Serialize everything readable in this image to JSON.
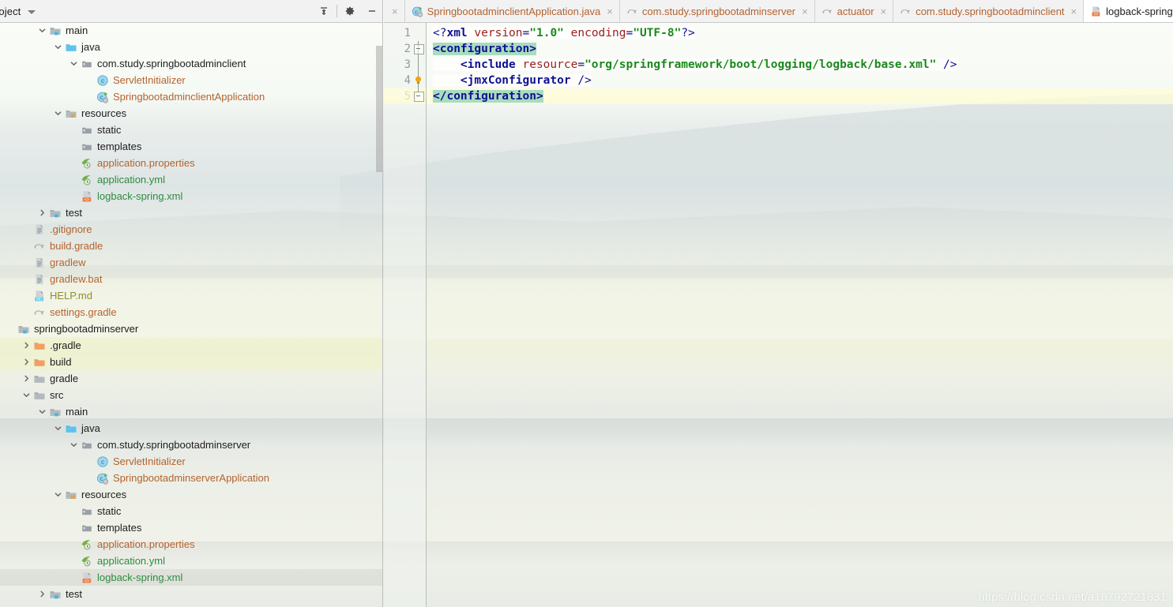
{
  "panel": {
    "title": "roject",
    "caret_icon": "chevron-down-icon",
    "tools": [
      {
        "name": "collapse-all-icon",
        "label": "Collapse All"
      },
      {
        "name": "gear-icon",
        "label": "Settings"
      },
      {
        "name": "minimize-icon",
        "label": "Hide"
      }
    ]
  },
  "tree": [
    {
      "depth": 2,
      "label": "main",
      "icon": "source-folder-icon",
      "arrow": "down",
      "color": "dark"
    },
    {
      "depth": 3,
      "label": "java",
      "icon": "java-folder-icon",
      "arrow": "down",
      "color": "dark"
    },
    {
      "depth": 4,
      "label": "com.study.springbootadminclient",
      "icon": "package-icon",
      "arrow": "down",
      "color": "dark"
    },
    {
      "depth": 5,
      "label": "ServletInitializer",
      "icon": "class-icon",
      "arrow": "none",
      "color": "orange"
    },
    {
      "depth": 5,
      "label": "SpringbootadminclientApplication",
      "icon": "runnable-class-icon",
      "arrow": "none",
      "color": "orange"
    },
    {
      "depth": 3,
      "label": "resources",
      "icon": "resources-folder-icon",
      "arrow": "down",
      "color": "dark"
    },
    {
      "depth": 4,
      "label": "static",
      "icon": "folder-icon",
      "arrow": "none",
      "color": "dark"
    },
    {
      "depth": 4,
      "label": "templates",
      "icon": "folder-icon",
      "arrow": "none",
      "color": "dark"
    },
    {
      "depth": 4,
      "label": "application.properties",
      "icon": "spring-properties-icon",
      "arrow": "none",
      "color": "orange"
    },
    {
      "depth": 4,
      "label": "application.yml",
      "icon": "spring-yaml-icon",
      "arrow": "none",
      "color": "green"
    },
    {
      "depth": 4,
      "label": "logback-spring.xml",
      "icon": "xml-icon",
      "arrow": "none",
      "color": "green"
    },
    {
      "depth": 2,
      "label": "test",
      "icon": "test-folder-icon",
      "arrow": "right",
      "color": "dark"
    },
    {
      "depth": 1,
      "label": ".gitignore",
      "icon": "file-icon",
      "arrow": "none",
      "color": "orange"
    },
    {
      "depth": 1,
      "label": "build.gradle",
      "icon": "gradle-icon",
      "arrow": "none",
      "color": "orange"
    },
    {
      "depth": 1,
      "label": "gradlew",
      "icon": "file-icon",
      "arrow": "none",
      "color": "orange"
    },
    {
      "depth": 1,
      "label": "gradlew.bat",
      "icon": "file-icon",
      "arrow": "none",
      "color": "orange"
    },
    {
      "depth": 1,
      "label": "HELP.md",
      "icon": "markdown-icon",
      "arrow": "none",
      "color": "olive"
    },
    {
      "depth": 1,
      "label": "settings.gradle",
      "icon": "gradle-icon",
      "arrow": "none",
      "color": "orange"
    },
    {
      "depth": 0,
      "label": "springbootadminserver",
      "icon": "module-icon",
      "arrow": "none",
      "color": "dark"
    },
    {
      "depth": 1,
      "label": ".gradle",
      "icon": "excluded-folder-icon",
      "arrow": "right",
      "color": "dark",
      "highlight": "a"
    },
    {
      "depth": 1,
      "label": "build",
      "icon": "excluded-folder-icon",
      "arrow": "right",
      "color": "dark",
      "highlight": "a"
    },
    {
      "depth": 1,
      "label": "gradle",
      "icon": "plain-folder-icon",
      "arrow": "right",
      "color": "dark"
    },
    {
      "depth": 1,
      "label": "src",
      "icon": "plain-folder-icon",
      "arrow": "down",
      "color": "dark"
    },
    {
      "depth": 2,
      "label": "main",
      "icon": "source-folder-icon",
      "arrow": "down",
      "color": "dark"
    },
    {
      "depth": 3,
      "label": "java",
      "icon": "java-folder-icon",
      "arrow": "down",
      "color": "dark"
    },
    {
      "depth": 4,
      "label": "com.study.springbootadminserver",
      "icon": "package-icon",
      "arrow": "down",
      "color": "dark"
    },
    {
      "depth": 5,
      "label": "ServletInitializer",
      "icon": "class-icon",
      "arrow": "none",
      "color": "orange"
    },
    {
      "depth": 5,
      "label": "SpringbootadminserverApplication",
      "icon": "runnable-class-icon",
      "arrow": "none",
      "color": "orange"
    },
    {
      "depth": 3,
      "label": "resources",
      "icon": "resources-folder-icon",
      "arrow": "down",
      "color": "dark"
    },
    {
      "depth": 4,
      "label": "static",
      "icon": "folder-icon",
      "arrow": "none",
      "color": "dark"
    },
    {
      "depth": 4,
      "label": "templates",
      "icon": "folder-icon",
      "arrow": "none",
      "color": "dark"
    },
    {
      "depth": 4,
      "label": "application.properties",
      "icon": "spring-properties-icon",
      "arrow": "none",
      "color": "orange"
    },
    {
      "depth": 4,
      "label": "application.yml",
      "icon": "spring-yaml-icon",
      "arrow": "none",
      "color": "green"
    },
    {
      "depth": 4,
      "label": "logback-spring.xml",
      "icon": "xml-icon",
      "arrow": "none",
      "color": "green",
      "selected": true
    },
    {
      "depth": 2,
      "label": "test",
      "icon": "test-folder-icon",
      "arrow": "right",
      "color": "dark"
    }
  ],
  "tabs": [
    {
      "label": "",
      "icon": "partial-tab-icon",
      "active": false,
      "partial": true,
      "close": "×"
    },
    {
      "label": "SpringbootadminclientApplication.java",
      "icon": "runnable-class-icon",
      "active": false,
      "close": "×"
    },
    {
      "label": "com.study.springbootadminserver",
      "icon": "gradle-icon",
      "active": false,
      "close": "×"
    },
    {
      "label": "actuator",
      "icon": "gradle-icon",
      "active": false,
      "close": "×"
    },
    {
      "label": "com.study.springbootadminclient",
      "icon": "gradle-icon",
      "active": false,
      "close": "×"
    },
    {
      "label": "logback-spring",
      "icon": "xml-icon",
      "active": true,
      "close": ""
    }
  ],
  "editor": {
    "line_numbers": [
      "1",
      "2",
      "3",
      "4",
      "5"
    ],
    "current_line": 5,
    "lines": [
      {
        "n": 1,
        "tokens": [
          {
            "t": "<?",
            "c": "t-punct"
          },
          {
            "t": "xml",
            "c": "t-tag"
          },
          {
            "t": " version",
            "c": "t-attr"
          },
          {
            "t": "=",
            "c": "t-eq"
          },
          {
            "t": "\"1.0\"",
            "c": "t-val"
          },
          {
            "t": " encoding",
            "c": "t-attr"
          },
          {
            "t": "=",
            "c": "t-eq"
          },
          {
            "t": "\"UTF-8\"",
            "c": "t-val"
          },
          {
            "t": "?>",
            "c": "t-punct"
          }
        ]
      },
      {
        "n": 2,
        "tokens": [
          {
            "t": "<configuration>",
            "c": "t-tag hlg"
          }
        ]
      },
      {
        "n": 3,
        "tokens": [
          {
            "t": "    ",
            "c": ""
          },
          {
            "t": "<include",
            "c": "t-tag"
          },
          {
            "t": " resource",
            "c": "t-attr"
          },
          {
            "t": "=",
            "c": "t-eq"
          },
          {
            "t": "\"org/springframework/boot/logging/logback/base.xml\"",
            "c": "t-val"
          },
          {
            "t": " />",
            "c": "t-punct"
          }
        ]
      },
      {
        "n": 4,
        "tokens": [
          {
            "t": "    ",
            "c": ""
          },
          {
            "t": "<jmxConfigurator",
            "c": "t-tag"
          },
          {
            "t": " />",
            "c": "t-punct"
          }
        ]
      },
      {
        "n": 5,
        "tokens": [
          {
            "t": "</configuration>",
            "c": "t-tag hlg"
          }
        ]
      }
    ],
    "gutter_icons": [
      {
        "line": 2,
        "name": "fold-collapse-icon"
      },
      {
        "line": 4,
        "name": "intention-bulb-icon"
      },
      {
        "line": 5,
        "name": "fold-end-icon"
      }
    ]
  },
  "watermark": {
    "text": "https://blog.csdn.net/a18792721831"
  },
  "colors": {
    "accent_orange": "#b4622f",
    "accent_green": "#2e8b3f",
    "tag_blue": "#101090",
    "value_green": "#1a8a1a",
    "attr_red": "#9b1d1d",
    "highlight_green": "#a8dcc0",
    "current_line": "#fffcd6"
  }
}
